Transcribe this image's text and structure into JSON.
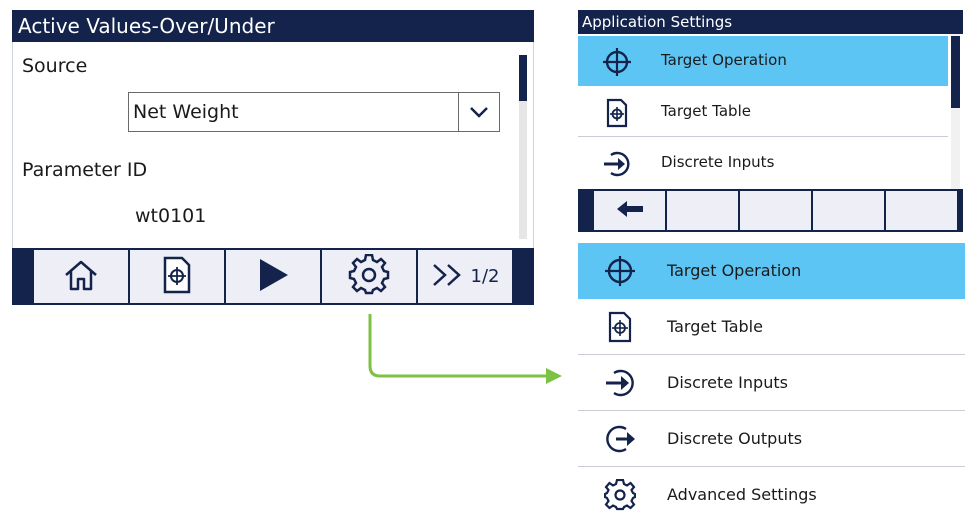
{
  "left_panel": {
    "title": "Active Values-Over/Under",
    "source_label": "Source",
    "source_value": "Net Weight",
    "param_label": "Parameter ID",
    "param_value": "wt0101",
    "softkeys": [
      {
        "icon": "home-icon"
      },
      {
        "icon": "target-table-icon"
      },
      {
        "icon": "play-icon"
      },
      {
        "icon": "gear-icon"
      },
      {
        "icon": "next-page-icon",
        "label": "1/2"
      }
    ]
  },
  "right_top_panel": {
    "title": "Application Settings",
    "items": [
      {
        "label": "Target Operation",
        "icon": "crosshair-icon",
        "selected": true
      },
      {
        "label": "Target Table",
        "icon": "target-table-icon"
      },
      {
        "label": "Discrete Inputs",
        "icon": "discrete-input-icon"
      }
    ],
    "softkeys": [
      {
        "icon": "back-arrow-icon"
      },
      {},
      {},
      {},
      {}
    ]
  },
  "right_bottom_list": {
    "items": [
      {
        "label": "Target Operation",
        "icon": "crosshair-icon",
        "selected": true
      },
      {
        "label": "Target Table",
        "icon": "target-table-icon"
      },
      {
        "label": "Discrete Inputs",
        "icon": "discrete-input-icon"
      },
      {
        "label": "Discrete Outputs",
        "icon": "discrete-output-icon"
      },
      {
        "label": "Advanced Settings",
        "icon": "gear-icon"
      }
    ]
  },
  "colors": {
    "header_navy": "#13234b",
    "selection_blue": "#5dc5f3",
    "arrow_green": "#7dc242",
    "softkey_bg": "#eeeef6"
  }
}
